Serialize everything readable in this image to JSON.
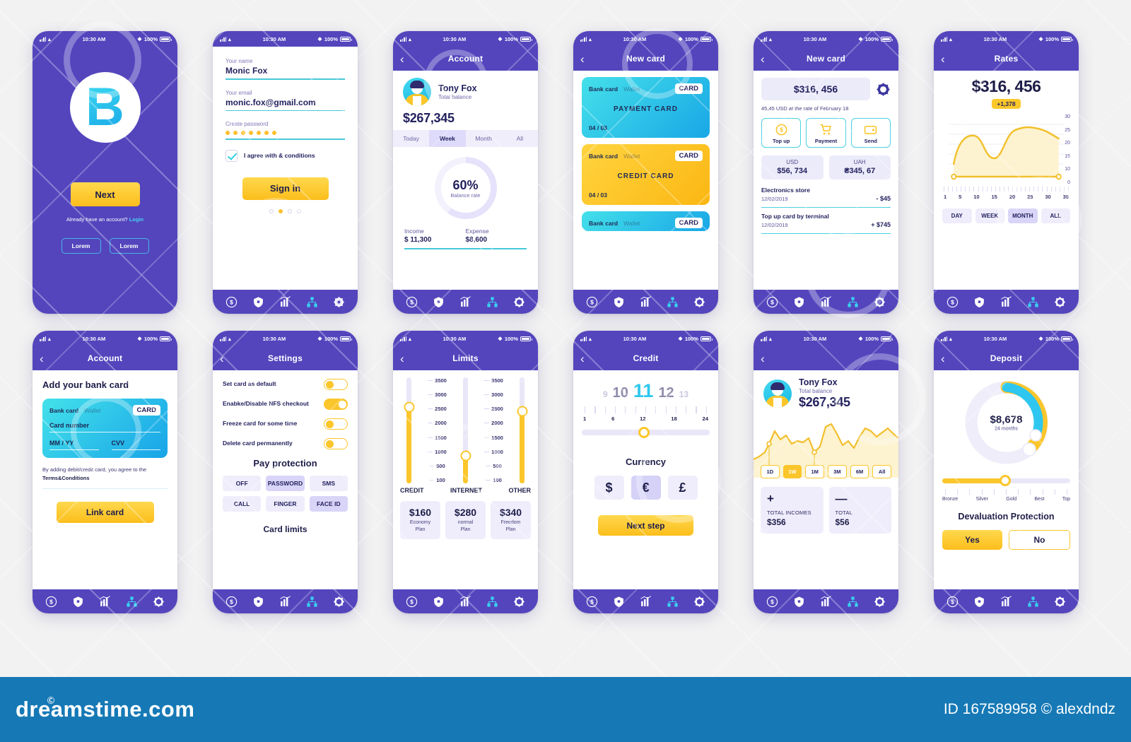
{
  "statusbar": {
    "time": "10:30 AM",
    "battery": "100%"
  },
  "tabbar": {
    "icons": [
      "dollar-icon",
      "shield-lock-icon",
      "bar-chart-icon",
      "org-chart-icon",
      "gear-icon"
    ]
  },
  "screens": [
    {
      "id": "splash",
      "logo_letter": "B",
      "next_label": "Next",
      "have_account": "Already have an account?",
      "login_label": "Login",
      "lorem_1": "Lorem",
      "lorem_2": "Lorem"
    },
    {
      "id": "signup",
      "fields": [
        {
          "label": "Your name",
          "value": "Monic Fox"
        },
        {
          "label": "Your email",
          "value": "monic.fox@gmail.com"
        },
        {
          "label": "Create password",
          "value": "●●●●●●●"
        }
      ],
      "agree_label": "I agree with & conditions",
      "signin_label": "Sign in",
      "pager_active": 1,
      "pager_count": 4
    },
    {
      "id": "account",
      "title": "Account",
      "name": "Tony Fox",
      "balance_label": "Total balance",
      "balance": "$267,345",
      "segments": [
        "Today",
        "Week",
        "Month",
        "All"
      ],
      "segment_active": "Week",
      "donut_pct": "60%",
      "donut_caption": "Balance rate",
      "income_label": "Income",
      "income_value": "$ 11,300",
      "expense_label": "Expense",
      "expense_value": "$8,600"
    },
    {
      "id": "new-card-list",
      "title": "New card",
      "cards": [
        {
          "left": "Bank card",
          "mid": "Wallet",
          "badge": "CARD",
          "name": "PAYMENT CARD",
          "expiry": "04 / 03",
          "color": "cyan"
        },
        {
          "left": "Bank card",
          "mid": "Wallet",
          "badge": "CARD",
          "name": "CREDIT CARD",
          "expiry": "04 / 03",
          "color": "gold"
        },
        {
          "left": "Bank card",
          "mid": "Wallet",
          "badge": "CARD",
          "name": "",
          "expiry": "",
          "color": "cyan"
        }
      ]
    },
    {
      "id": "new-card-detail",
      "title": "New card",
      "amount": "$316, 456",
      "rate_note": "45,45 USD at the rate of February 18",
      "actions": [
        {
          "label": "Top up",
          "icon": "coin-dollar-icon"
        },
        {
          "label": "Payment",
          "icon": "shopping-cart-icon"
        },
        {
          "label": "Send",
          "icon": "wallet-icon"
        }
      ],
      "currencies": [
        {
          "name": "USD",
          "value": "$56, 734"
        },
        {
          "name": "UAH",
          "value": "₴345, 67"
        }
      ],
      "transactions": [
        {
          "name": "Electronics store",
          "date": "12/02/2019",
          "amount": "- $45"
        },
        {
          "name": "Top up card by terminal",
          "date": "12/02/2019",
          "amount": "+ $745"
        }
      ]
    },
    {
      "id": "rates",
      "title": "Rates",
      "amount": "$316, 456",
      "delta": "+1,378",
      "periods": [
        "DAY",
        "WEEK",
        "MONTH",
        "ALL"
      ],
      "period_active": "MONTH"
    },
    {
      "id": "add-card",
      "title": "Account",
      "heading": "Add your bank card",
      "card": {
        "left": "Bank card",
        "mid": "Wallet",
        "badge": "CARD",
        "number_label": "Card number",
        "mmyy_label": "MM / YY",
        "cvv_label": "CVV"
      },
      "note": "By adding debit/credit card, you agree to the",
      "note_bold": "Terms&Conditions",
      "link_label": "Link card"
    },
    {
      "id": "settings",
      "title": "Settings",
      "toggles": [
        {
          "label": "Set card as default",
          "on": false
        },
        {
          "label": "Enabke/Disable NFS checkout",
          "on": true
        },
        {
          "label": "Freeze card for some time",
          "on": false
        },
        {
          "label": "Delete card permanently",
          "on": false
        }
      ],
      "pay_protection_title": "Pay protection",
      "chips": [
        "OFF",
        "PASSWORD",
        "SMS",
        "CALL",
        "FINGER",
        "FACE ID"
      ],
      "chips_active": [
        "PASSWORD",
        "FACE ID"
      ],
      "footer_label": "Card limits"
    },
    {
      "id": "limits",
      "title": "Limits",
      "scale": [
        "3500",
        "3000",
        "2500",
        "2000",
        "1500",
        "1000",
        "500",
        "100"
      ],
      "columns": [
        "CREDIT",
        "INTERNET",
        "OTHER"
      ],
      "plans": [
        {
          "amount": "$160",
          "caption": "Economy\nPlan"
        },
        {
          "amount": "$280",
          "caption": "normal\nPlan"
        },
        {
          "amount": "$340",
          "caption": "Freedom\nPlan"
        }
      ]
    },
    {
      "id": "credit",
      "title": "Credit",
      "big_numbers": [
        "9",
        "10",
        "11",
        "12",
        "13"
      ],
      "selected_number": "11",
      "scale": [
        "1",
        "6",
        "12",
        "18",
        "24"
      ],
      "currency_title": "Currency",
      "currencies": [
        "$",
        "€",
        "£"
      ],
      "currency_active": "€",
      "next_label": "Next step"
    },
    {
      "id": "stats",
      "name": "Tony Fox",
      "balance_label": "Total balance",
      "balance": "$267,345",
      "ranges": [
        "1D",
        "1W",
        "1M",
        "3M",
        "6M",
        "All"
      ],
      "range_active": "1W",
      "totals": [
        {
          "sign": "+",
          "label": "TOTAL INCOMES",
          "value": "$356"
        },
        {
          "sign": "—",
          "label": "TOTAL",
          "value": "$56"
        }
      ]
    },
    {
      "id": "deposit",
      "title": "Deposit",
      "amount": "$8,678",
      "caption": "24 months",
      "tiers": [
        "Bronze",
        "Silver",
        "Gold",
        "Best",
        "Top"
      ],
      "protection_title": "Devaluation Protection",
      "yes_label": "Yes",
      "no_label": "No"
    }
  ],
  "chart_data": [
    {
      "type": "area",
      "title": "Rates",
      "x": [
        1,
        5,
        10,
        15,
        20,
        25,
        30,
        35
      ],
      "values": [
        7,
        14,
        18,
        11,
        9,
        20,
        26,
        24
      ],
      "xlabel": "",
      "ylabel": "",
      "ylim": [
        0,
        30
      ],
      "yticks": [
        30,
        25,
        20,
        15,
        10,
        0
      ],
      "grid": true,
      "color": "#f5c33a"
    },
    {
      "type": "area",
      "title": "Balance history",
      "x": [
        0,
        1,
        2,
        3,
        4,
        5,
        6,
        7,
        8,
        9,
        10,
        11,
        12,
        13,
        14
      ],
      "values": [
        28,
        35,
        52,
        70,
        58,
        66,
        49,
        52,
        38,
        74,
        82,
        60,
        48,
        72,
        66
      ],
      "grid": false,
      "color": "#f5c33a"
    },
    {
      "type": "pie",
      "title": "Balance rate",
      "categories": [
        "Used",
        "Remaining"
      ],
      "values": [
        60,
        40
      ],
      "labels": [
        "60%",
        ""
      ]
    },
    {
      "type": "pie",
      "title": "Deposit ring",
      "categories": [
        "Gold",
        "Cyan",
        "Empty"
      ],
      "values": [
        46,
        18,
        36
      ],
      "labels": [
        "$8,678",
        "24 months",
        ""
      ],
      "colors": [
        "#fbc62b",
        "#2fc7ef",
        "#ece9f9"
      ]
    },
    {
      "type": "bar",
      "title": "Limits sliders",
      "categories": [
        "CREDIT",
        "INTERNET",
        "OTHER"
      ],
      "values": [
        2500,
        1000,
        2400
      ],
      "ylim": [
        100,
        3500
      ],
      "ylabel": "Limit"
    }
  ],
  "footer": {
    "brand": "dreamstime.com",
    "id_text": "ID 167589958 © alexdndz"
  }
}
